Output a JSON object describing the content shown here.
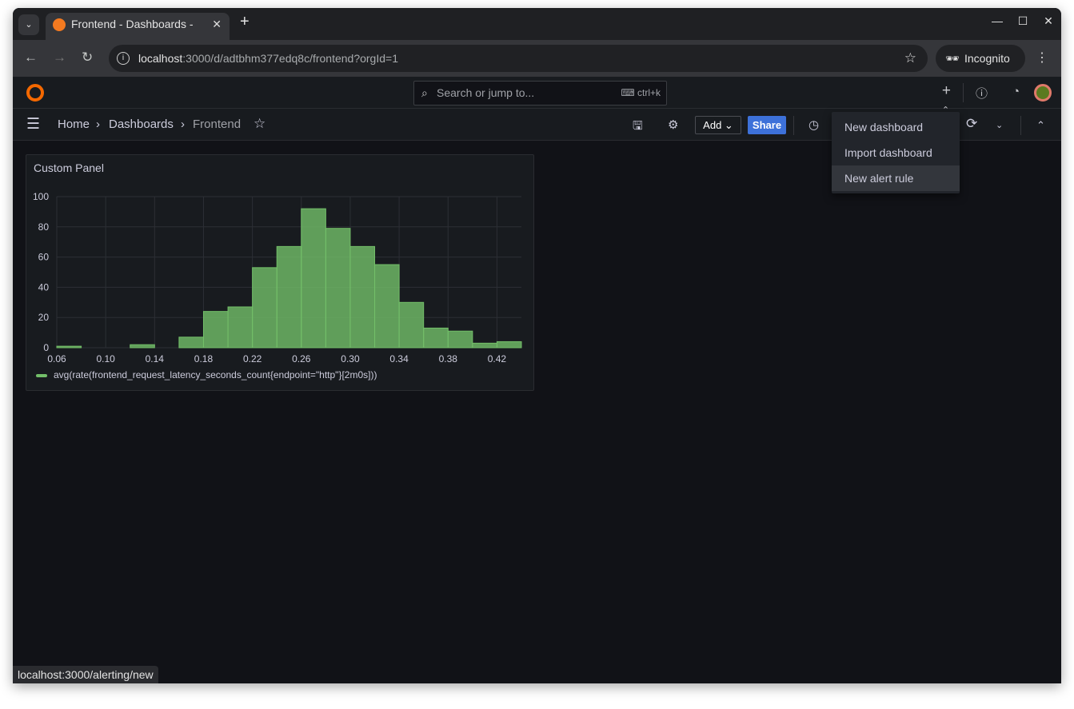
{
  "browser": {
    "tab_title": "Frontend - Dashboards -",
    "url_host": "localhost",
    "url_rest": ":3000/d/adtbhm377edq8c/frontend?orgId=1",
    "profile": "Incognito",
    "status_url": "localhost:3000/alerting/new"
  },
  "topbar": {
    "search_placeholder": "Search or jump to...",
    "shortcut": "ctrl+k"
  },
  "breadcrumb": {
    "home": "Home",
    "dashboards": "Dashboards",
    "current": "Frontend",
    "sep": "›"
  },
  "toolbar": {
    "add_label": "Add",
    "share_label": "Share"
  },
  "menu": {
    "items": [
      "New dashboard",
      "Import dashboard",
      "New alert rule"
    ],
    "highlighted": 2
  },
  "panel": {
    "title": "Custom Panel",
    "legend": "avg(rate(frontend_request_latency_seconds_count{endpoint=\"http\"}[2m0s]))"
  },
  "colors": {
    "series": "#73bf69",
    "accent": "#3d71d9"
  },
  "chart_data": {
    "type": "bar",
    "subtype": "histogram",
    "bin_start": [
      0.06,
      0.08,
      0.1,
      0.12,
      0.14,
      0.16,
      0.18,
      0.2,
      0.22,
      0.24,
      0.26,
      0.28,
      0.3,
      0.32,
      0.34,
      0.36,
      0.38,
      0.4,
      0.42
    ],
    "bin_width": 0.02,
    "values": [
      1,
      0,
      0,
      2,
      0,
      7,
      24,
      27,
      53,
      67,
      92,
      79,
      67,
      55,
      30,
      13,
      11,
      3,
      4
    ],
    "xlim": [
      0.06,
      0.44
    ],
    "ylim": [
      0,
      100
    ],
    "xticks": [
      "0.06",
      "0.10",
      "0.14",
      "0.18",
      "0.22",
      "0.26",
      "0.30",
      "0.34",
      "0.38",
      "0.42"
    ],
    "yticks": [
      "0",
      "20",
      "40",
      "60",
      "80",
      "100"
    ],
    "grid": true,
    "legend": "bottom-left"
  }
}
